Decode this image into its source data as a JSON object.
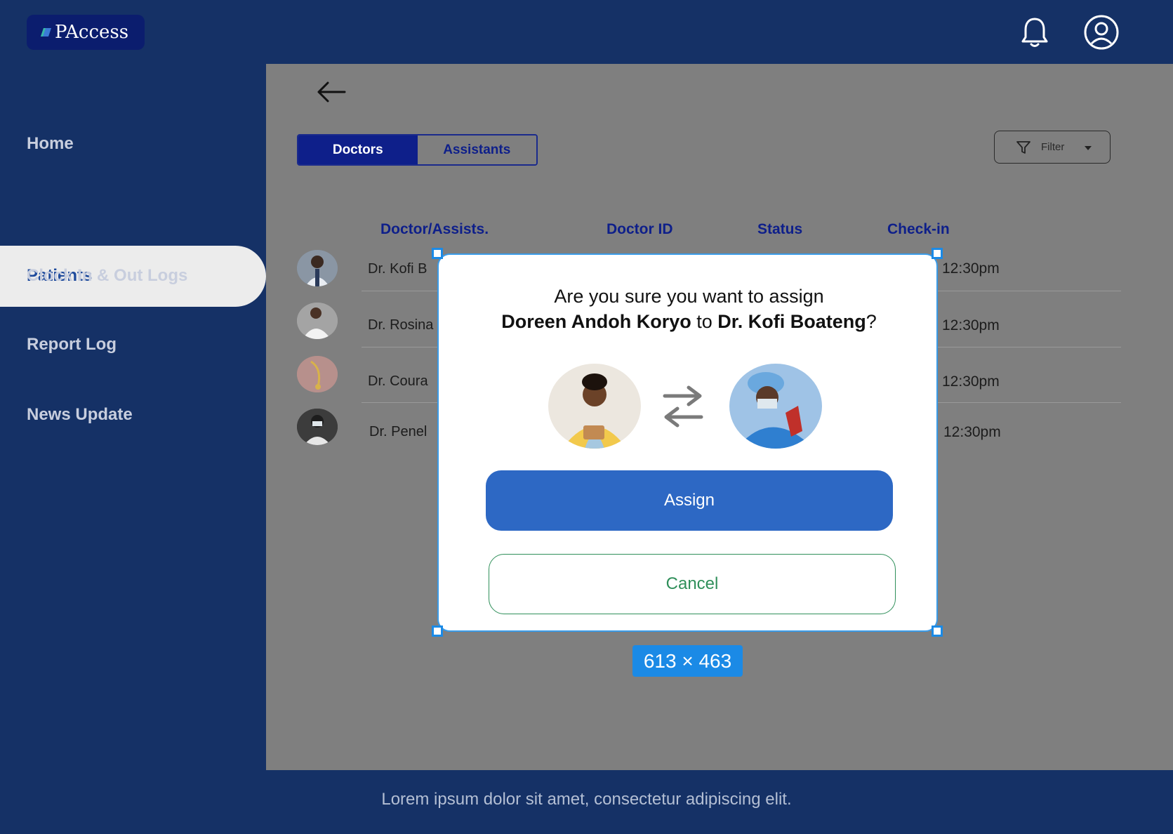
{
  "app": {
    "logo_text": "PAccess"
  },
  "header": {
    "notifications_icon": "bell-icon",
    "profile_icon": "user-circle-icon"
  },
  "sidebar": {
    "items": [
      {
        "label": "Home",
        "active": false
      },
      {
        "label": "Patients",
        "active": true
      },
      {
        "label": "Clock  In & Out Logs",
        "active": false
      },
      {
        "label": "Report Log",
        "active": false
      },
      {
        "label": "News Update",
        "active": false
      }
    ]
  },
  "main": {
    "back_icon": "arrow-left-icon",
    "tabs": [
      {
        "label": "Doctors",
        "selected": true
      },
      {
        "label": "Assistants",
        "selected": false
      }
    ],
    "filter": {
      "label": "Filter",
      "icon": "funnel-icon"
    },
    "table": {
      "headers": [
        "Doctor/Assists.",
        "Doctor ID",
        "Status",
        "Check-in"
      ],
      "rows": [
        {
          "name": "Dr. Kofi B",
          "checkin": "12:30pm"
        },
        {
          "name": "Dr. Rosina",
          "checkin": "12:30pm"
        },
        {
          "name": "Dr. Coura",
          "checkin": "12:30pm"
        },
        {
          "name": "Dr. Penel",
          "checkin": "12:30pm"
        }
      ]
    }
  },
  "modal": {
    "question_line1": "Are you sure you want to assign",
    "assignee": "Doreen Andoh Koryo",
    "connector": " to ",
    "doctor": "Dr. Kofi Boateng",
    "suffix": "?",
    "swap_icon": "swap-arrows-icon",
    "assign_label": "Assign",
    "cancel_label": "Cancel"
  },
  "selection_dims": "613 × 463",
  "footer": {
    "text": "Lorem ipsum dolor sit amet, consectetur adipiscing elit."
  },
  "colors": {
    "navy": "#153166",
    "primary_button": "#2d68c4",
    "cancel_green": "#2f8f5a",
    "selection_blue": "#1b8ae6"
  }
}
